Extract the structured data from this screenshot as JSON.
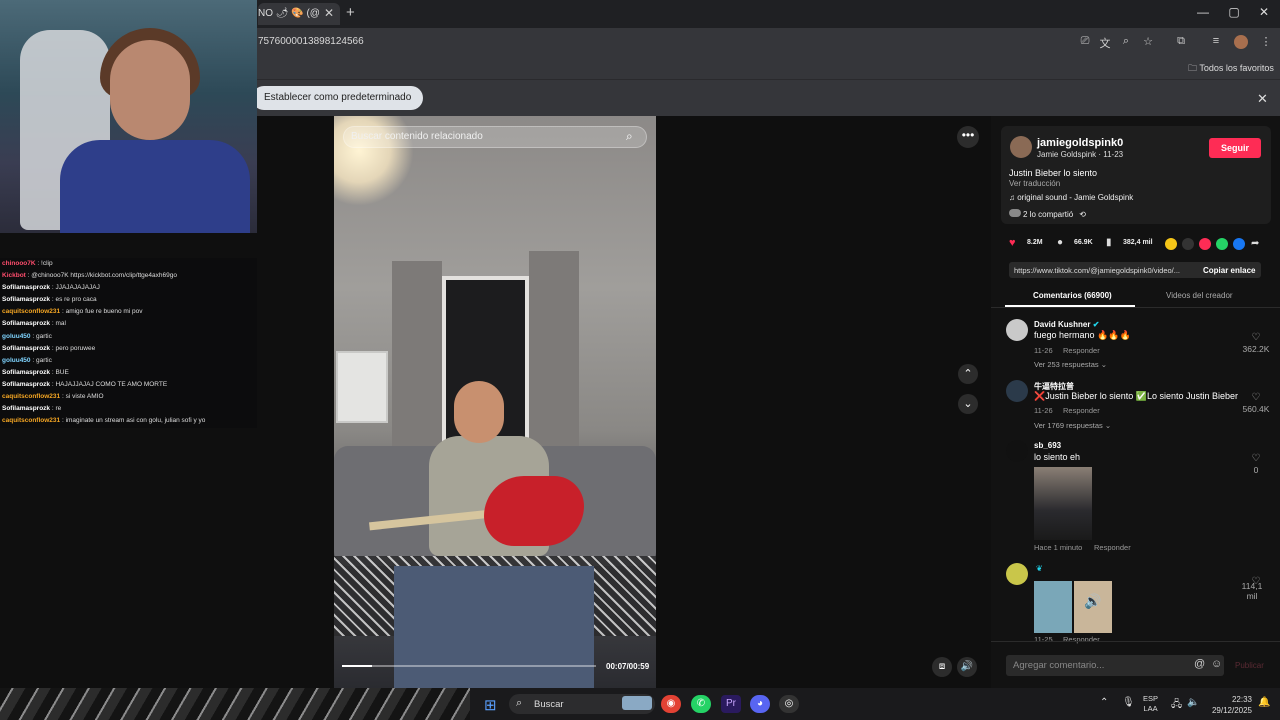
{
  "browser": {
    "tab_title": "NO 🌶 🎨 (@",
    "tab_close": "✕",
    "new_tab": "+",
    "window_controls": [
      "—",
      "▢",
      "✕"
    ],
    "url": "7576000013898124566",
    "bookmarks_all": "Todos los favoritos",
    "infobar_button": "Establecer como predeterminado",
    "infobar_close": "✕"
  },
  "chat": [
    {
      "user": "chinooo7K",
      "msg": ": !clip",
      "color": "#ff4d6d"
    },
    {
      "user": "Kickbot",
      "msg": ": @chinooo7K https://kickbot.com/clip/ttge4axh69go",
      "color": "#ff4d6d"
    },
    {
      "user": "Sofilamasprozk",
      "msg": ": JJAJAJAJAJAJ",
      "color": "#ffffff"
    },
    {
      "user": "Sofilamasprozk",
      "msg": ": es re pro caca",
      "color": "#ffffff"
    },
    {
      "user": "caquitsconflow231",
      "msg": ": amigo fue re bueno mi pov",
      "color": "#f5a623"
    },
    {
      "user": "Sofilamasprozk",
      "msg": ": mal",
      "color": "#ffffff"
    },
    {
      "user": "goluu450",
      "msg": ": gartic",
      "color": "#7fd4ff"
    },
    {
      "user": "Sofilamasprozk",
      "msg": ": pero poruwee",
      "color": "#ffffff"
    },
    {
      "user": "goluu450",
      "msg": ": gartic",
      "color": "#7fd4ff"
    },
    {
      "user": "Sofilamasprozk",
      "msg": ": BUE",
      "color": "#ffffff"
    },
    {
      "user": "Sofilamasprozk",
      "msg": ": HAJAJJAJAJ COMO TE AMO MORTE",
      "color": "#ffffff"
    },
    {
      "user": "caquitsconflow231",
      "msg": ": si viste AMIO",
      "color": "#f5a623"
    },
    {
      "user": "Sofilamasprozk",
      "msg": ": re",
      "color": "#ffffff"
    },
    {
      "user": "caquitsconflow231",
      "msg": ": imaginate un stream asi con golu, julian sofi y yo",
      "color": "#f5a623"
    }
  ],
  "video": {
    "search_placeholder": "Buscar contenido relacionado",
    "time": "00:07/00:59",
    "progress": 0.12
  },
  "post": {
    "username": "jamiegoldspink0",
    "handle": "Jamie Goldspink · 11-23",
    "follow": "Seguir",
    "caption": "Justin Bieber lo siento",
    "translate": "Ver traducción",
    "sound": "♫  original sound - Jamie Goldspink",
    "shared": "2 lo compartió",
    "likes": "8.2M",
    "comments": "66.9K",
    "saves": "382,4 mil",
    "link": "https://www.tiktok.com/@jamiegoldspink0/video/...",
    "copy_link": "Copiar enlace",
    "tab_comments": "Comentarios (66900)",
    "tab_videos": "Videos del creador"
  },
  "comments": [
    {
      "user": "David Kushner",
      "text": "fuego hermano 🔥🔥🔥",
      "date": "11-26",
      "reply": "Responder",
      "more": "Ver 253 respuestas ⌄",
      "likes": "362.2K"
    },
    {
      "user": "牛逼特拉普",
      "text": "❌Justin Bieber lo siento ✅Lo siento Justin Bieber",
      "date": "11-26",
      "reply": "Responder",
      "more": "Ver 1769 respuestas ⌄",
      "likes": "560.4K"
    },
    {
      "user": "sb_693",
      "text": "lo siento eh",
      "date": "Hace 1 minuto",
      "reply": "Responder",
      "likes": "0"
    },
    {
      "user": "",
      "text": "",
      "date": "11-25",
      "reply": "Responder",
      "likes": "114,1\nmil"
    }
  ],
  "composer": {
    "placeholder": "Agregar comentario...",
    "publish": "Publicar"
  },
  "taskbar": {
    "search": "Buscar",
    "lang_line1": "ESP",
    "lang_line2": "LAA",
    "time": "22:33",
    "date": "29/12/2025"
  }
}
